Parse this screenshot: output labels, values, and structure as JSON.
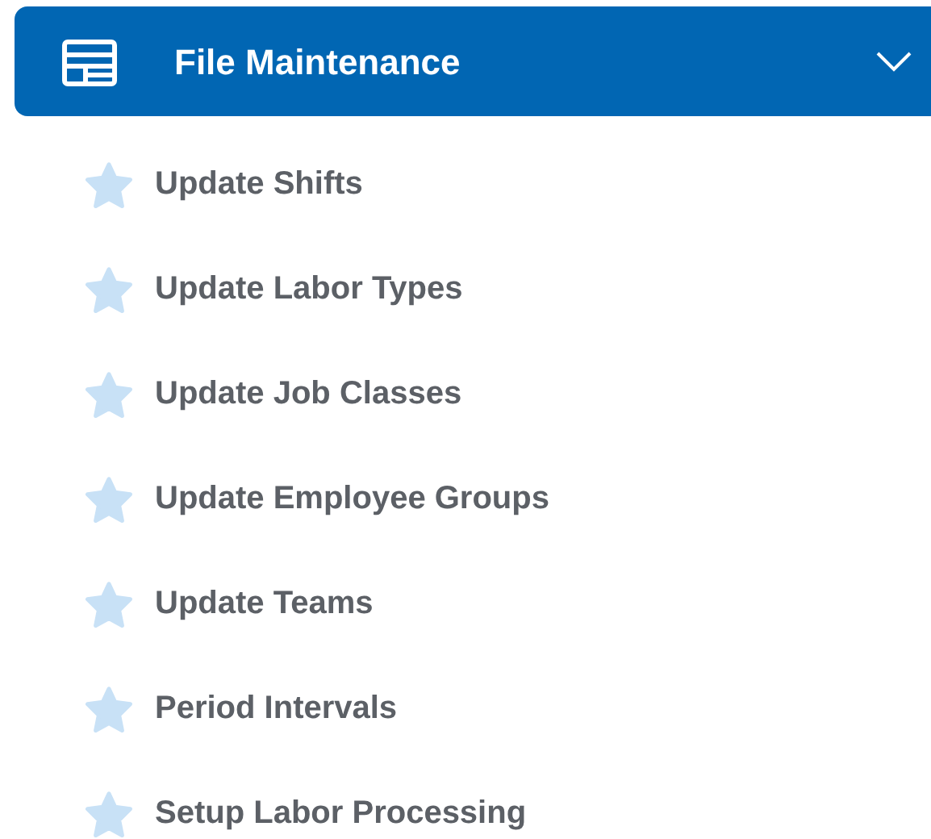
{
  "menu": {
    "title": "File Maintenance",
    "expanded": true,
    "items": [
      {
        "label": "Update Shifts"
      },
      {
        "label": "Update Labor Types"
      },
      {
        "label": "Update Job Classes"
      },
      {
        "label": "Update Employee Groups"
      },
      {
        "label": "Update Teams"
      },
      {
        "label": "Period Intervals"
      },
      {
        "label": "Setup Labor Processing"
      }
    ]
  }
}
